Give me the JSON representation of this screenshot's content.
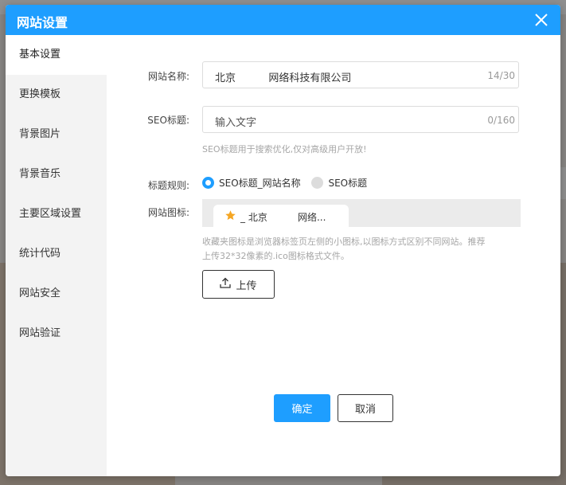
{
  "dialog": {
    "title": "网站设置"
  },
  "sidebar": {
    "items": [
      {
        "label": "基本设置",
        "active": true
      },
      {
        "label": "更换模板"
      },
      {
        "label": "背景图片"
      },
      {
        "label": "背景音乐"
      },
      {
        "label": "主要区域设置"
      },
      {
        "label": "统计代码"
      },
      {
        "label": "网站安全"
      },
      {
        "label": "网站验证"
      }
    ]
  },
  "form": {
    "site_name": {
      "label": "网站名称:",
      "value": "北京          网络科技有限公司",
      "count": "14/30"
    },
    "seo_title": {
      "label": "SEO标题:",
      "placeholder": "输入文字",
      "count": "0/160",
      "hint": "SEO标题用于搜索优化,仅对高级用户开放!"
    },
    "title_rule": {
      "label": "标题规则:",
      "options": [
        {
          "label": "SEO标题_网站名称",
          "selected": true
        },
        {
          "label": "SEO标题",
          "selected": false
        }
      ]
    },
    "favicon": {
      "label": "网站图标:",
      "tab_text": "_ 北京          网络...",
      "hint_line1": "收藏夹图标是浏览器标签页左侧的小图标,以图标方式区别不同网站。推荐",
      "hint_line2": "上传32*32像素的.ico图标格式文件。",
      "upload_label": "上传"
    }
  },
  "actions": {
    "confirm": "确定",
    "cancel": "取消"
  },
  "colors": {
    "accent": "#1e9eff",
    "star": "#f5a623"
  }
}
